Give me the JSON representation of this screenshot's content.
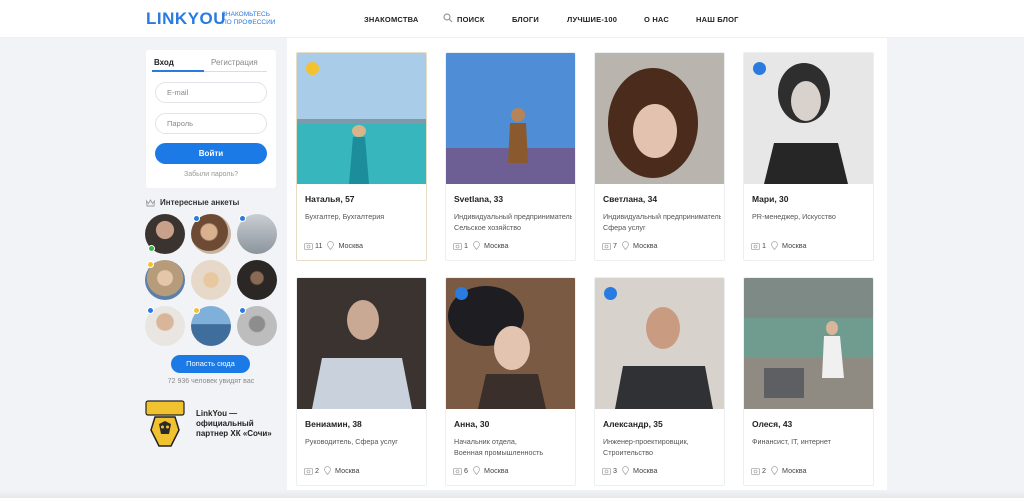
{
  "header": {
    "logo": "LINKYOU",
    "tagline_line1": "ЗНАКОМЬТЕСЬ",
    "tagline_line2": "ПО ПРОФЕССИИ",
    "nav": [
      "ЗНАКОМСТВА",
      "ПОИСК",
      "БЛОГИ",
      "ЛУЧШИЕ-100",
      "О НАС",
      "НАШ БЛОГ"
    ]
  },
  "login": {
    "tab_login": "Вход",
    "tab_register": "Регистрация",
    "email_placeholder": "E-mail",
    "password_placeholder": "Пароль",
    "submit": "Войти",
    "forgot": "Забыли пароль?"
  },
  "sidebar": {
    "interesting_title": "Интересные анкеты",
    "post_button": "Попасть сюда",
    "viewers": "72 936 человек увидят вас",
    "partner_line1": "LinkYou —",
    "partner_line2": "официальный",
    "partner_line3": "партнер ХК «Сочи»"
  },
  "profiles": [
    {
      "name": "Наталья, 57",
      "job1": "Бухгалтер, Бухгалтерия",
      "job2": "",
      "photos": "11",
      "city": "Москва",
      "badge": "crown"
    },
    {
      "name": "Svetlana, 33",
      "job1": "Индивидуальный предприниматель",
      "job2": "Сельское хозяйство",
      "photos": "1",
      "city": "Москва",
      "badge": ""
    },
    {
      "name": "Светлана, 34",
      "job1": "Индивидуальный предприниматель",
      "job2": "Сфера услуг",
      "photos": "7",
      "city": "Москва",
      "badge": ""
    },
    {
      "name": "Мари, 30",
      "job1": "PR-менеджер, Искусство",
      "job2": "",
      "photos": "1",
      "city": "Москва",
      "badge": "star"
    },
    {
      "name": "Вениамин, 38",
      "job1": "Руководитель, Сфера услуг",
      "job2": "",
      "photos": "2",
      "city": "Москва",
      "badge": ""
    },
    {
      "name": "Анна, 30",
      "job1": "Начальник отдела,",
      "job2": "Военная промышленность",
      "photos": "6",
      "city": "Москва",
      "badge": "star"
    },
    {
      "name": "Александр, 35",
      "job1": "Инженер-проектировщик,",
      "job2": "Строительство",
      "photos": "3",
      "city": "Москва",
      "badge": "star"
    },
    {
      "name": "Олеся, 43",
      "job1": "Финансист, IT, интернет",
      "job2": "",
      "photos": "2",
      "city": "Москва",
      "badge": ""
    }
  ],
  "colors": {
    "accent": "#1b7ae6",
    "crown_badge": "#f2c230",
    "star_badge": "#2a7be0"
  }
}
